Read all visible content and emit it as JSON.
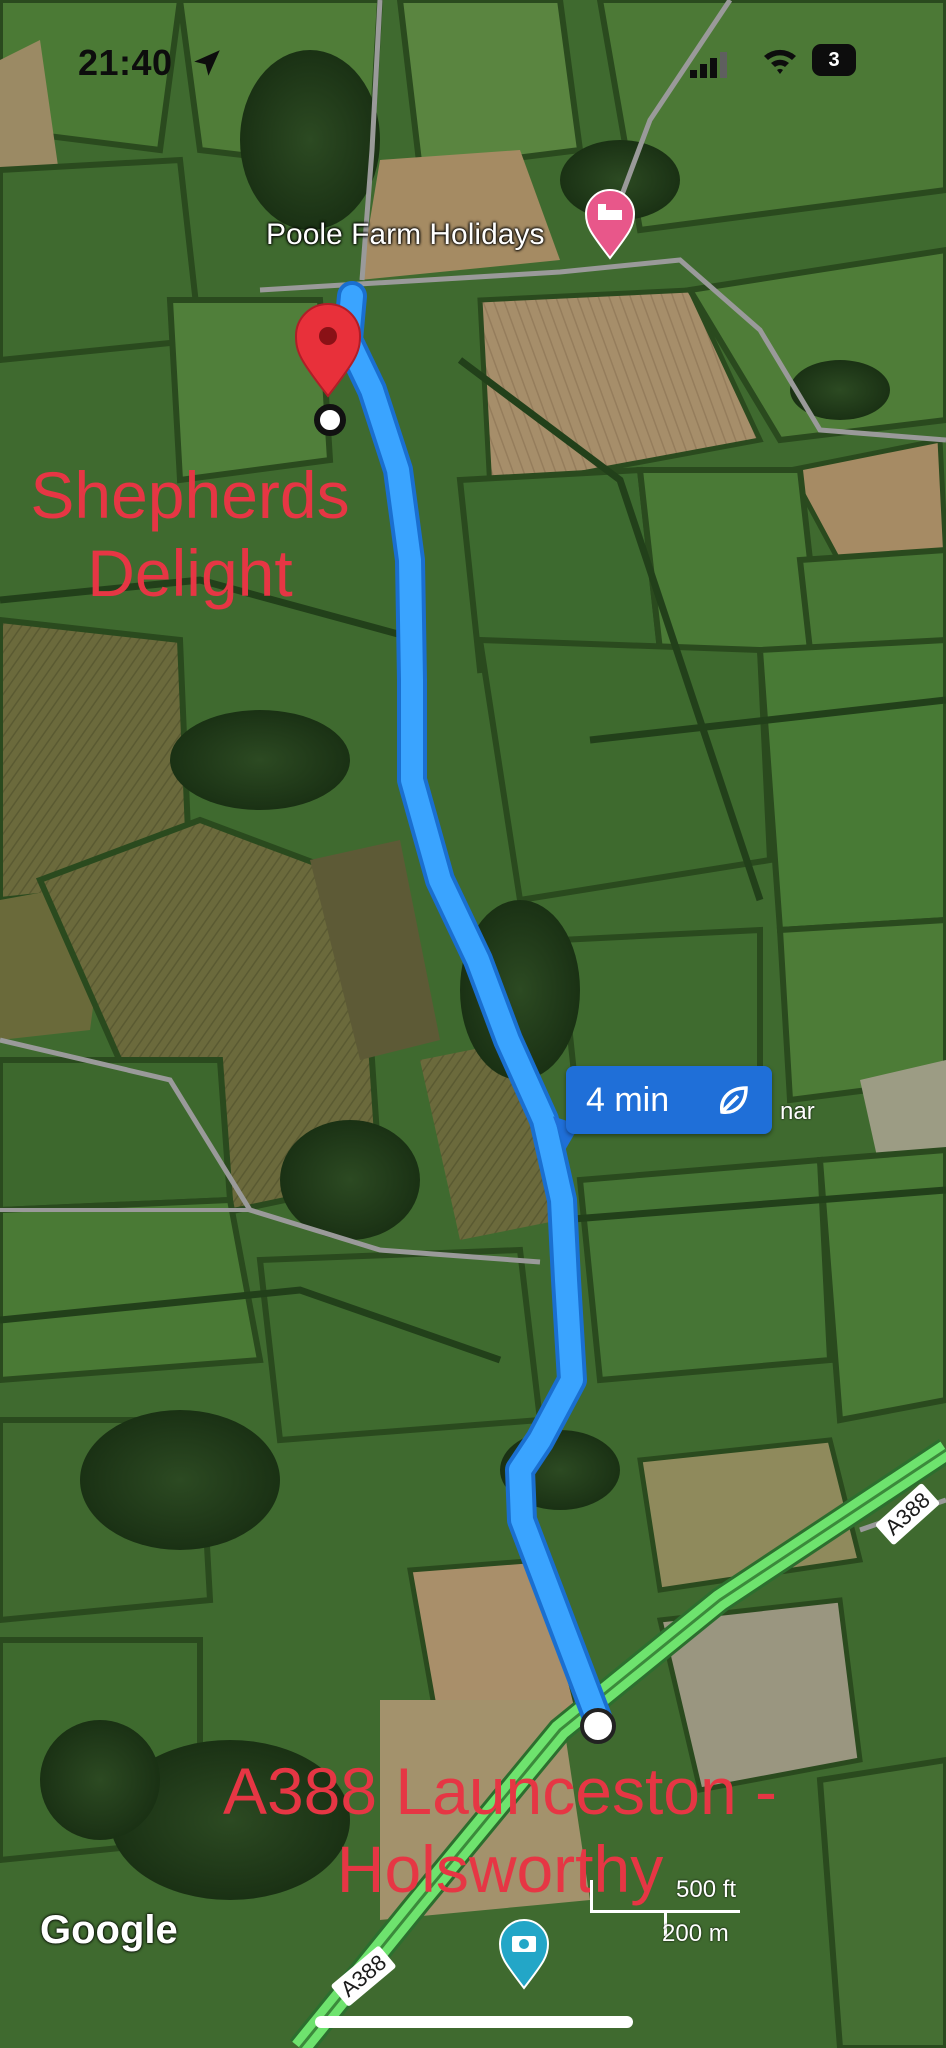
{
  "status_bar": {
    "time": "21:40",
    "battery": "3"
  },
  "map": {
    "poi": {
      "label": "Poole Farm Holidays",
      "icon": "hotel-bed-icon",
      "color": "#e8578a"
    },
    "place_label_partial": "nar",
    "route": {
      "eta": "4 min",
      "eco_icon": "leaf-icon",
      "color": "#3aa4ff"
    },
    "road_labels": [
      "A388",
      "A388"
    ],
    "attribution": "Google",
    "scale": {
      "feet": "500 ft",
      "meters": "200 m"
    },
    "photo_poi_icon": "camera-icon"
  },
  "annotations": {
    "destination_lines": [
      "Shepherds",
      "Delight"
    ],
    "origin_lines": [
      "A388 Launceston -",
      "Holsworthy"
    ],
    "color": "#e63644"
  }
}
